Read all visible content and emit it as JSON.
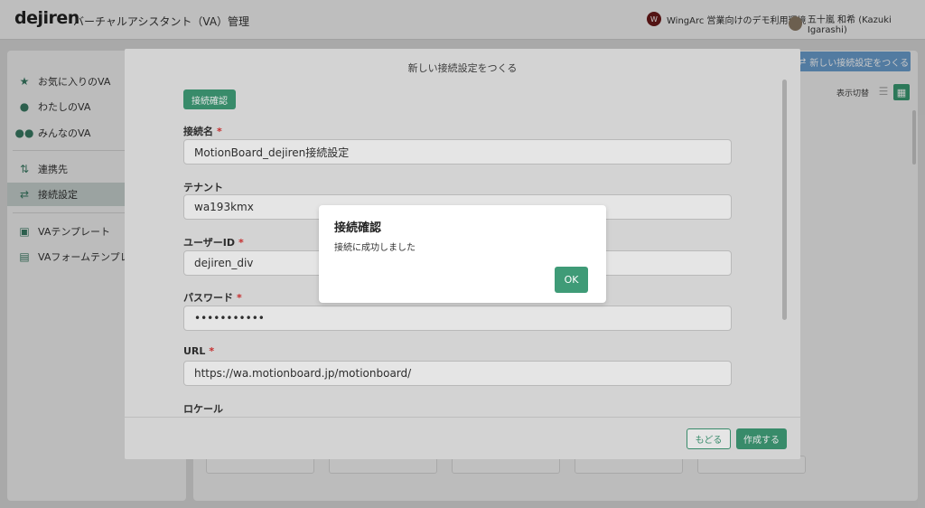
{
  "header": {
    "logo": "dejiren",
    "app_title": "バーチャルアシスタント（VA）管理",
    "org_badge": "W",
    "org_name": "WingArc 営業向けのデモ利用環境",
    "user_name": "五十嵐 和希 (Kazuki Igarashi)"
  },
  "sidebar": {
    "items": [
      {
        "label": "お気に入りのVA",
        "icon": "star-icon"
      },
      {
        "label": "わたしのVA",
        "icon": "person-icon"
      },
      {
        "label": "みんなのVA",
        "icon": "people-icon"
      },
      {
        "label": "連携先",
        "icon": "link-icon"
      },
      {
        "label": "接続設定",
        "icon": "connection-icon"
      },
      {
        "label": "VAテンプレート",
        "icon": "template-icon"
      },
      {
        "label": "VAフォームテンプレート",
        "icon": "form-template-icon"
      }
    ],
    "active": "接続設定"
  },
  "main": {
    "create_button": "新しい接続設定をつくる",
    "view_toggle_label": "表示切替"
  },
  "modal": {
    "title": "新しい接続設定をつくる",
    "check_button": "接続確認",
    "fields": [
      {
        "label": "接続名",
        "required": true,
        "value": "MotionBoard_dejiren接続設定"
      },
      {
        "label": "テナント",
        "required": false,
        "value": "wa193kmx"
      },
      {
        "label": "ユーザーID",
        "required": true,
        "value": "dejiren_div"
      },
      {
        "label": "パスワード",
        "required": true,
        "value": "•••••••••••"
      },
      {
        "label": "URL",
        "required": true,
        "value": "https://wa.motionboard.jp/motionboard/"
      },
      {
        "label": "ロケール",
        "required": false,
        "value": ""
      }
    ],
    "back_button": "もどる",
    "create_button": "作成する"
  },
  "dialog": {
    "title": "接続確認",
    "message": "接続に成功しました",
    "ok_button": "OK"
  },
  "colors": {
    "primary_green": "#3f9b77",
    "header_blue": "#6a9ecf",
    "required_red": "#dd3333"
  }
}
